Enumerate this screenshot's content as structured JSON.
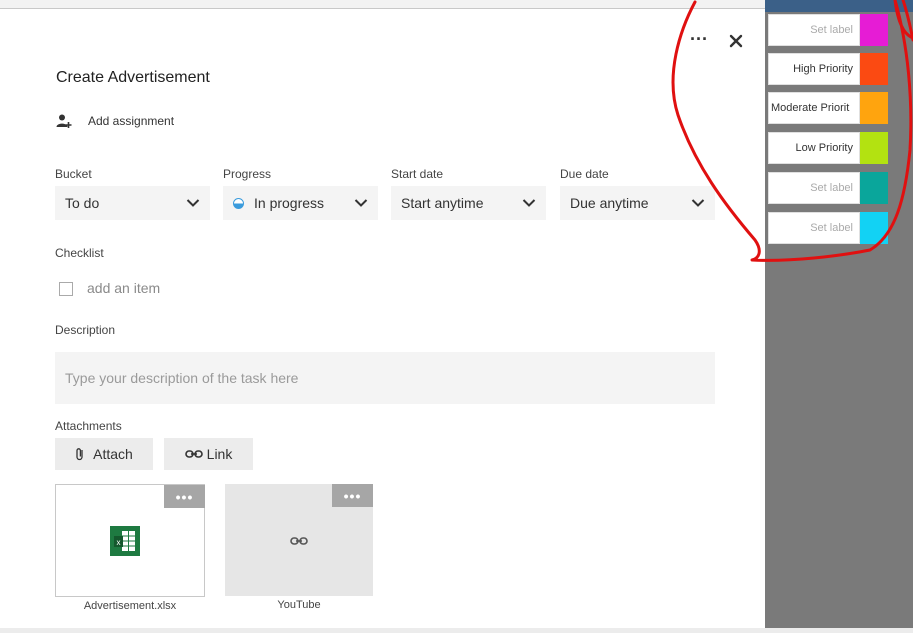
{
  "dialog": {
    "title": "Create Advertisement",
    "more_label": "···",
    "assign_label": "Add assignment"
  },
  "fields": {
    "bucket": {
      "label": "Bucket",
      "value": "To do"
    },
    "progress": {
      "label": "Progress",
      "value": "In progress"
    },
    "start": {
      "label": "Start date",
      "value": "Start anytime"
    },
    "due": {
      "label": "Due date",
      "value": "Due anytime"
    }
  },
  "checklist": {
    "label": "Checklist",
    "placeholder": "add an item"
  },
  "description": {
    "label": "Description",
    "placeholder": "Type your description of the task here"
  },
  "attachments": {
    "label": "Attachments",
    "attach_label": "Attach",
    "link_label": "Link",
    "more": "•••",
    "items": [
      {
        "name": "Advertisement.xlsx",
        "icon": "excel-file-icon"
      },
      {
        "name": "YouTube",
        "icon": "link-icon"
      }
    ]
  },
  "labels": [
    {
      "text": "Set label",
      "color": "#e61cd5",
      "placeholder": true
    },
    {
      "text": "High Priority",
      "color": "#fb4a12",
      "placeholder": false
    },
    {
      "text": "Moderate Priorit",
      "color": "#ffa40e",
      "placeholder": false,
      "editing": true
    },
    {
      "text": "Low Priority",
      "color": "#b3e211",
      "placeholder": false
    },
    {
      "text": "Set label",
      "color": "#0aa69b",
      "placeholder": true
    },
    {
      "text": "Set label",
      "color": "#12d2f4",
      "placeholder": true
    }
  ],
  "colors": {
    "accent": "#3a9bdc",
    "annotation": "#e01010",
    "excel": "#1e7a41"
  }
}
